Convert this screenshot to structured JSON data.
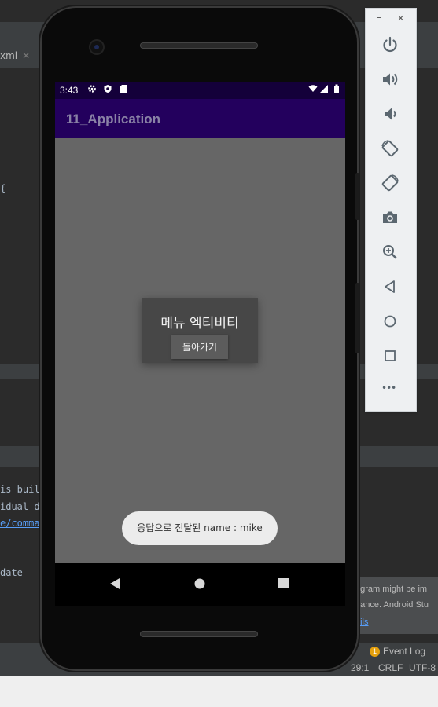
{
  "ide": {
    "tab_label": "xml",
    "tab_close": "✕",
    "code_brace": "{",
    "console_line1": "is buil",
    "console_line2": "idual d",
    "console_link": "e/comma",
    "console_line4": "date",
    "notice_line1": "ogram might be im",
    "notice_line2": "nance. Android Stu",
    "notice_link": "gils",
    "event_log_count": "1",
    "event_log_label": "Event Log",
    "cursor_pos": "29:1",
    "line_sep": "CRLF",
    "encoding": "UTF-8"
  },
  "phone": {
    "status_time": "3:43",
    "app_title": "11_Application",
    "dialog": {
      "title": "메뉴 엑티비티",
      "button_label": "돌아가기"
    },
    "toast_text": "응답으로 전달된 name : mike"
  },
  "emulator": {
    "minimize": "–",
    "close": "✕",
    "more": "•••"
  },
  "colors": {
    "app_bar": "#23005d",
    "status_bar": "#14003a",
    "screen_bg": "#666666",
    "ide_bg": "#2b2b2b"
  }
}
